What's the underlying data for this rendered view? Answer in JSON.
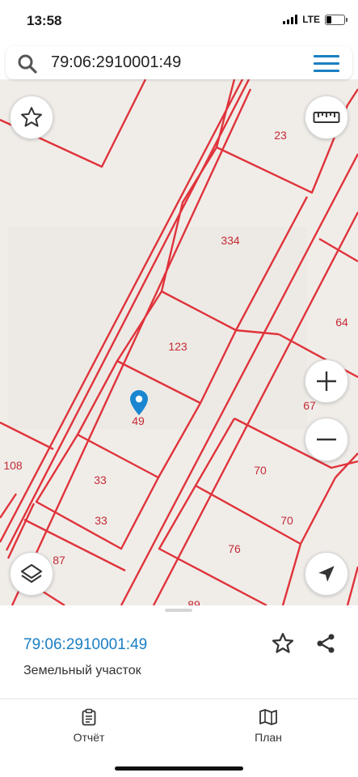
{
  "status_bar": {
    "time": "13:58",
    "network": "LTE",
    "battery_level": 0.3
  },
  "search": {
    "value": "79:06:2910001:49"
  },
  "map": {
    "parcel_labels": [
      "23",
      "334",
      "64",
      "123",
      "67",
      "49",
      "108",
      "70",
      "33",
      "70",
      "33",
      "76",
      "87",
      "89"
    ],
    "marker": "selected-parcel-pin"
  },
  "controls": {
    "favorite": "star-icon",
    "ruler": "ruler-icon",
    "zoom_in": "+",
    "zoom_out": "−",
    "layers": "layers-icon",
    "locate": "locate-arrow-icon"
  },
  "sheet": {
    "cadastral_number": "79:06:2910001:49",
    "parcel_type": "Земельный участок"
  },
  "bottom_nav": [
    {
      "label": "Отчёт",
      "icon": "report-clipboard-icon"
    },
    {
      "label": "План",
      "icon": "map-plan-icon"
    }
  ],
  "colors": {
    "accent": "#1a7fc3",
    "parcel_line": "#e0333b",
    "parcel_label": "#c42a35",
    "map_bg": "#f0ede9"
  }
}
